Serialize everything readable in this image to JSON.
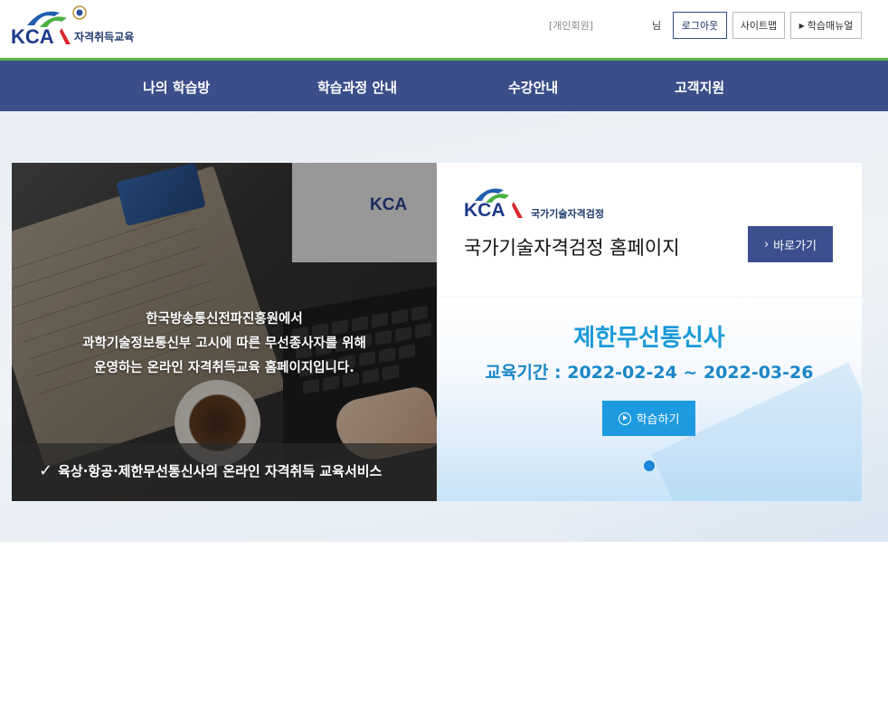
{
  "header": {
    "logo_text": "KCA",
    "logo_sub": "자격취득교육",
    "member_tag": "[개인회원]",
    "user_suffix": "님",
    "logout_label": "로그아웃",
    "sitemap_label": "사이트맵",
    "manual_label": "학습매뉴얼"
  },
  "nav": {
    "items": [
      "나의 학습방",
      "학습과정 안내",
      "수강안내",
      "고객지원"
    ]
  },
  "banner": {
    "screen_logo": "KCA",
    "lines": [
      "한국방송통신전파진흥원에서",
      "과학기술정보통신부 고시에 따른 무선종사자를 위해",
      "운영하는 온라인 자격취득교육 홈페이지입니다."
    ],
    "bottom_text": "육상·항공·제한무선통신사의 온라인 자격취득 교육서비스"
  },
  "national_cert": {
    "logo_text": "KCA",
    "logo_sub": "국가기술자격검정",
    "title": "국가기술자격검정 홈페이지",
    "go_label": "바로가기"
  },
  "course": {
    "title": "제한무선통신사",
    "period": "교육기간 : 2022-02-24 ~ 2022-03-26",
    "study_label": "학습하기"
  },
  "colors": {
    "nav_bg": "#3b4e89",
    "nav_accent": "#57b448",
    "brand_blue": "#1e3a8a",
    "course_blue": "#1a9ad8",
    "study_button": "#1c9be0"
  }
}
